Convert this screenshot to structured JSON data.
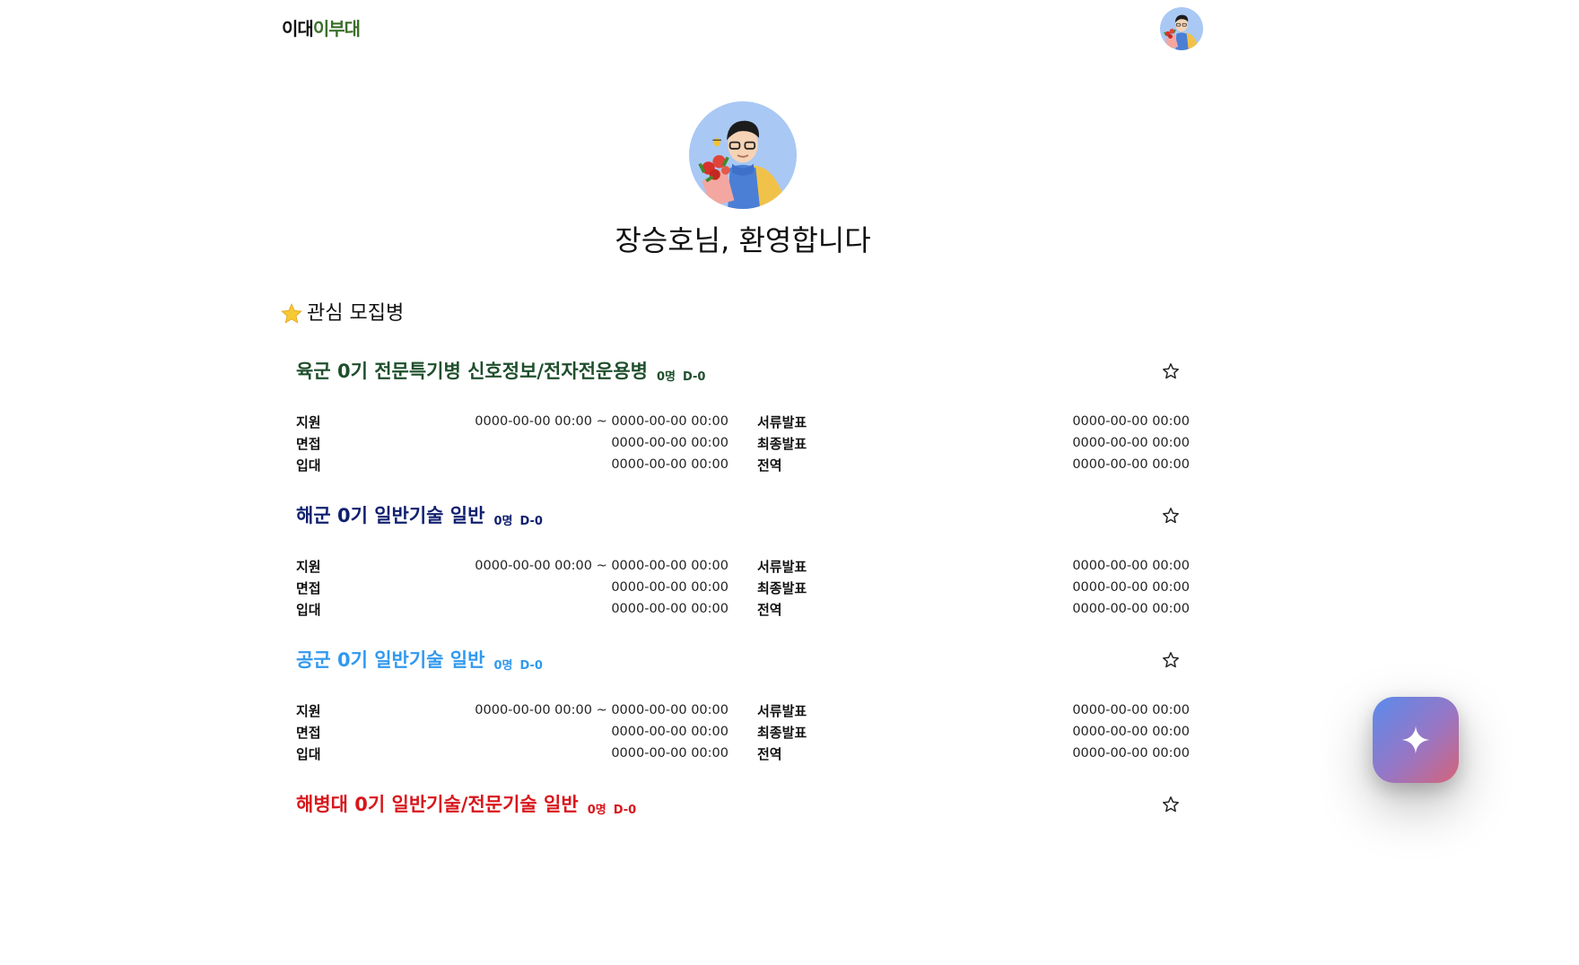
{
  "header": {
    "logo_part1": "이대",
    "logo_part2": "이부대"
  },
  "profile": {
    "welcome": "장승호님, 환영합니다"
  },
  "section": {
    "title": "관심 모집병",
    "icon": "star-emoji-icon"
  },
  "labels": {
    "apply": "지원",
    "doc_announce": "서류발표",
    "interview": "면접",
    "final_announce": "최종발표",
    "enlist": "입대",
    "discharge": "전역"
  },
  "recruits": [
    {
      "name": "육군 0기 전문특기병 신호정보/전자전운용병",
      "count": "0명",
      "dday": "D-0",
      "color": "#1f4f2c",
      "apply": "0000-00-00 00:00 ~ 0000-00-00 00:00",
      "doc_announce": "0000-00-00 00:00",
      "interview": "0000-00-00 00:00",
      "final_announce": "0000-00-00 00:00",
      "enlist": "0000-00-00 00:00",
      "discharge": "0000-00-00 00:00"
    },
    {
      "name": "해군 0기 일반기술 일반",
      "count": "0명",
      "dday": "D-0",
      "color": "#10206f",
      "apply": "0000-00-00 00:00 ~ 0000-00-00 00:00",
      "doc_announce": "0000-00-00 00:00",
      "interview": "0000-00-00 00:00",
      "final_announce": "0000-00-00 00:00",
      "enlist": "0000-00-00 00:00",
      "discharge": "0000-00-00 00:00"
    },
    {
      "name": "공군 0기 일반기술 일반",
      "count": "0명",
      "dday": "D-0",
      "color": "#3199ef",
      "apply": "0000-00-00 00:00 ~ 0000-00-00 00:00",
      "doc_announce": "0000-00-00 00:00",
      "interview": "0000-00-00 00:00",
      "final_announce": "0000-00-00 00:00",
      "enlist": "0000-00-00 00:00",
      "discharge": "0000-00-00 00:00"
    },
    {
      "name": "해병대 0기 일반기술/전문기술 일반",
      "count": "0명",
      "dday": "D-0",
      "color": "#d8161b"
    }
  ],
  "fab": {
    "icon": "sparkle-icon"
  }
}
